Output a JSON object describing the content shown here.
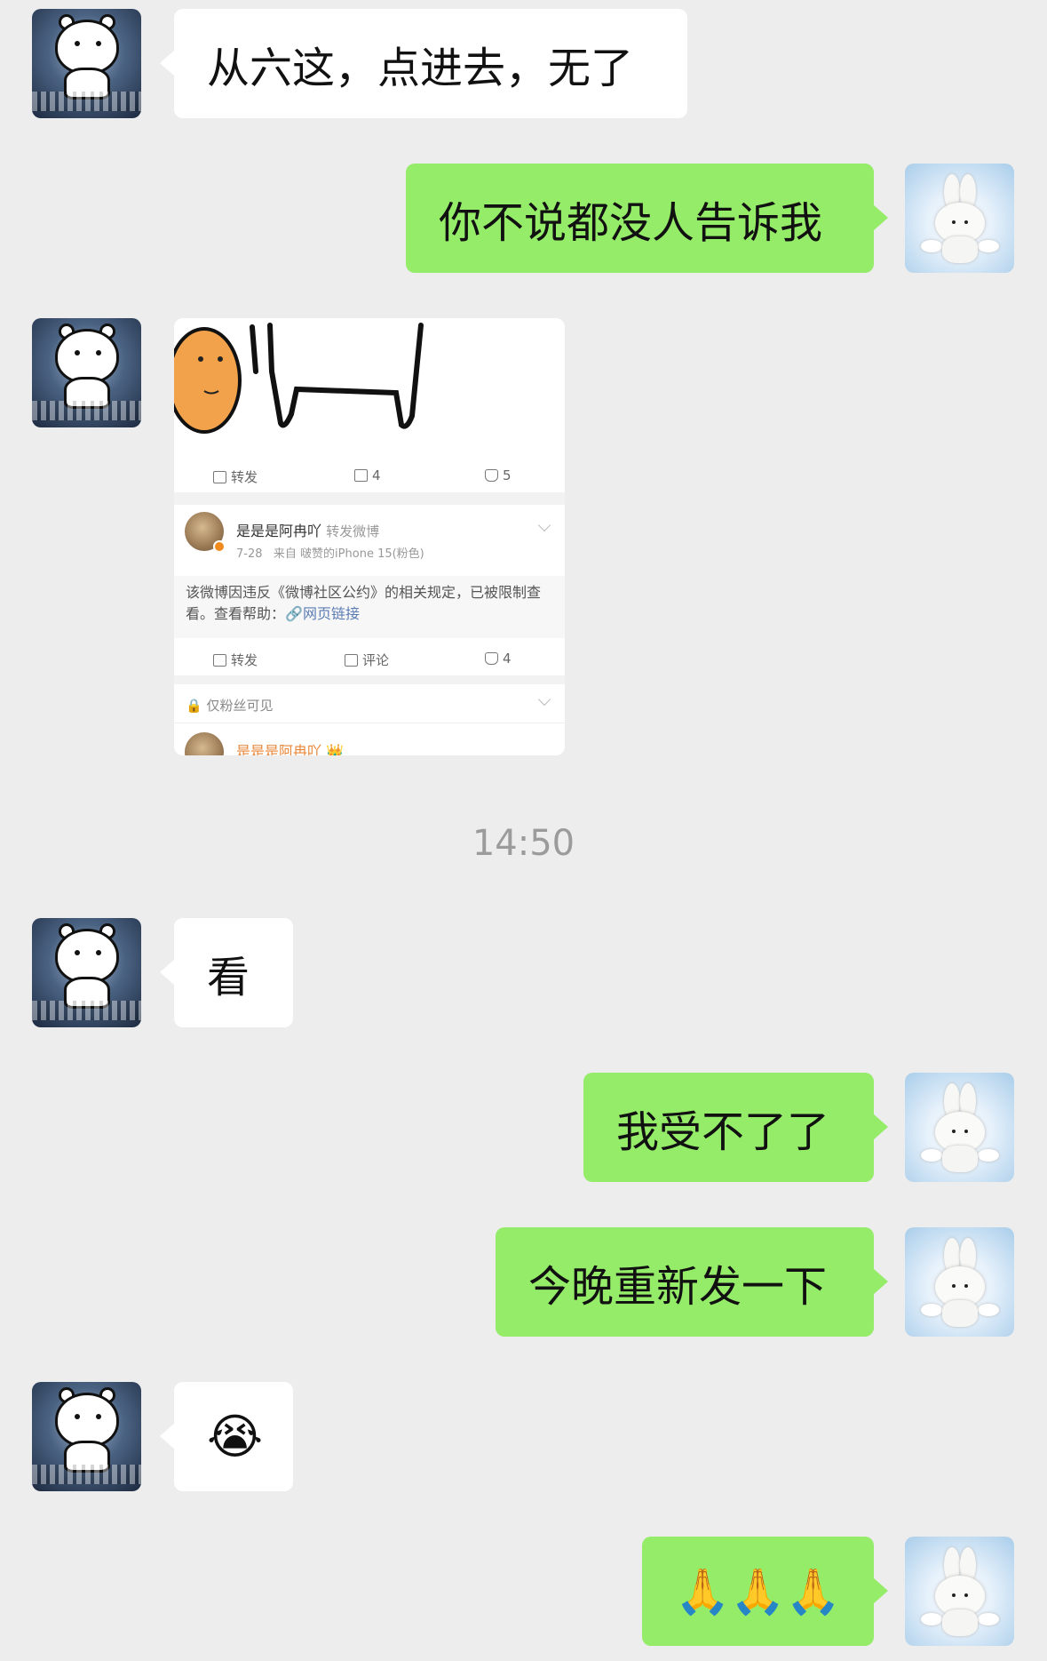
{
  "messages": [
    {
      "side": "left",
      "text": "从六这，点进去，无了"
    },
    {
      "side": "right",
      "text": "你不说都没人告诉我"
    },
    {
      "side": "left",
      "type": "image"
    },
    {
      "side": "left",
      "text": "看"
    },
    {
      "side": "right",
      "text": "我受不了了"
    },
    {
      "side": "right",
      "text": "今晚重新发一下"
    },
    {
      "side": "left",
      "text": "😭"
    },
    {
      "side": "right",
      "text": "🙏🙏🙏"
    }
  ],
  "timestamp": "14:50",
  "shared_image": {
    "post1_actions": {
      "repost": "转发",
      "comments": "4",
      "likes": "5"
    },
    "post2": {
      "author": "是是是阿冉吖",
      "repost_label": "转发微博",
      "date": "7-28",
      "source": "来自 啵赞的iPhone 15(粉色)",
      "notice_text": "该微博因违反《微博社区公约》的相关规定，已被限制查看。查看帮助：",
      "notice_link": "网页链接",
      "actions": {
        "repost": "转发",
        "comment": "评论",
        "likes": "4"
      }
    },
    "post3": {
      "visibility": "仅粉丝可见",
      "author": "是是是阿冉吖"
    }
  },
  "colors": {
    "background": "#ededed",
    "right_bubble": "#95ec69",
    "left_bubble": "#ffffff"
  }
}
